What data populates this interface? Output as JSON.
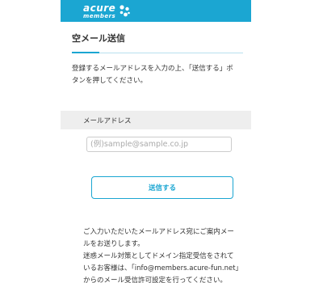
{
  "header": {
    "logo_main": "acure",
    "logo_sub": "members",
    "brand_color": "#1ba6d2"
  },
  "page": {
    "title": "空メール送信",
    "intro": "登録するメールアドレスを入力の上、「送信する」ボタンを押してください。"
  },
  "form": {
    "email_label": "メールアドレス",
    "email_placeholder": "(例)sample@sample.co.jp",
    "email_value": "",
    "submit_label": "送信する"
  },
  "notice": {
    "line1": "ご入力いただいたメールアドレス宛にご案内メールをお送りします。",
    "line2": "迷惑メール対策としてドメイン指定受信をされているお客様は、「info@members.acure-fun.net」からのメール受信許可設定を行ってください。"
  }
}
